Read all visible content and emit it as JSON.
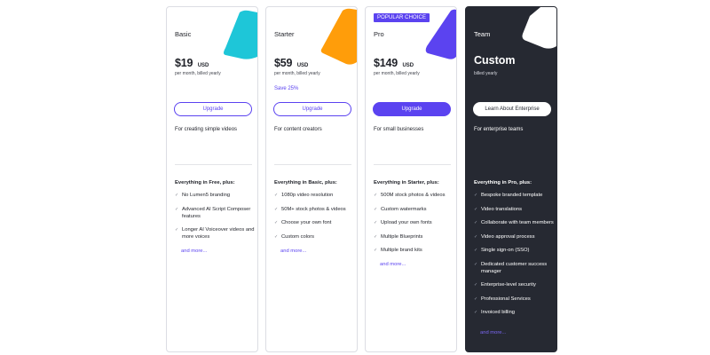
{
  "plans": [
    {
      "name": "Basic",
      "price": "$19",
      "currency": "USD",
      "billing": "per month, billed yearly",
      "button": "Upgrade",
      "description": "For creating simple videos",
      "features_heading": "Everything in Free, plus:",
      "features": [
        "No Lumen5 branding",
        "Advanced AI Script Composer features",
        "Longer AI Voiceover videos and more voices"
      ],
      "more": "and more...",
      "accent": "#1ec6d8"
    },
    {
      "name": "Starter",
      "price": "$59",
      "currency": "USD",
      "billing": "per month, billed yearly",
      "save": "Save 25%",
      "button": "Upgrade",
      "description": "For content creators",
      "features_heading": "Everything in Basic, plus:",
      "features": [
        "1080p video resolution",
        "50M+ stock photos & videos",
        "Choose your own font",
        "Custom colors"
      ],
      "more": "and more...",
      "accent": "#ff9d0a"
    },
    {
      "name": "Pro",
      "badge": "POPULAR CHOICE",
      "price": "$149",
      "currency": "USD",
      "billing": "per month, billed yearly",
      "button": "Upgrade",
      "description": "For small businesses",
      "features_heading": "Everything in Starter, plus:",
      "features": [
        "500M stock photos & videos",
        "Custom watermarks",
        "Upload your own fonts",
        "Multiple Blueprints",
        "Multiple brand kits"
      ],
      "more": "and more...",
      "accent": "#5b43f0"
    },
    {
      "name": "Team",
      "price": "Custom",
      "billing": "billed yearly",
      "button": "Learn About Enterprise",
      "description": "For enterprise teams",
      "features_heading": "Everything in Pro, plus:",
      "features": [
        "Bespoke branded template",
        "Video translations",
        "Collaborate with team members",
        "Video approval process",
        "Single sign-on (SSO)",
        "Dedicated customer success manager",
        "Enterprise-level security",
        "Professional Services",
        "Invoiced billing"
      ],
      "more": "and more...",
      "accent": "#ffffff"
    }
  ],
  "icons": {
    "check": "check-icon"
  },
  "colors": {
    "brand": "#5b43f0",
    "dark_card": "#262932"
  }
}
